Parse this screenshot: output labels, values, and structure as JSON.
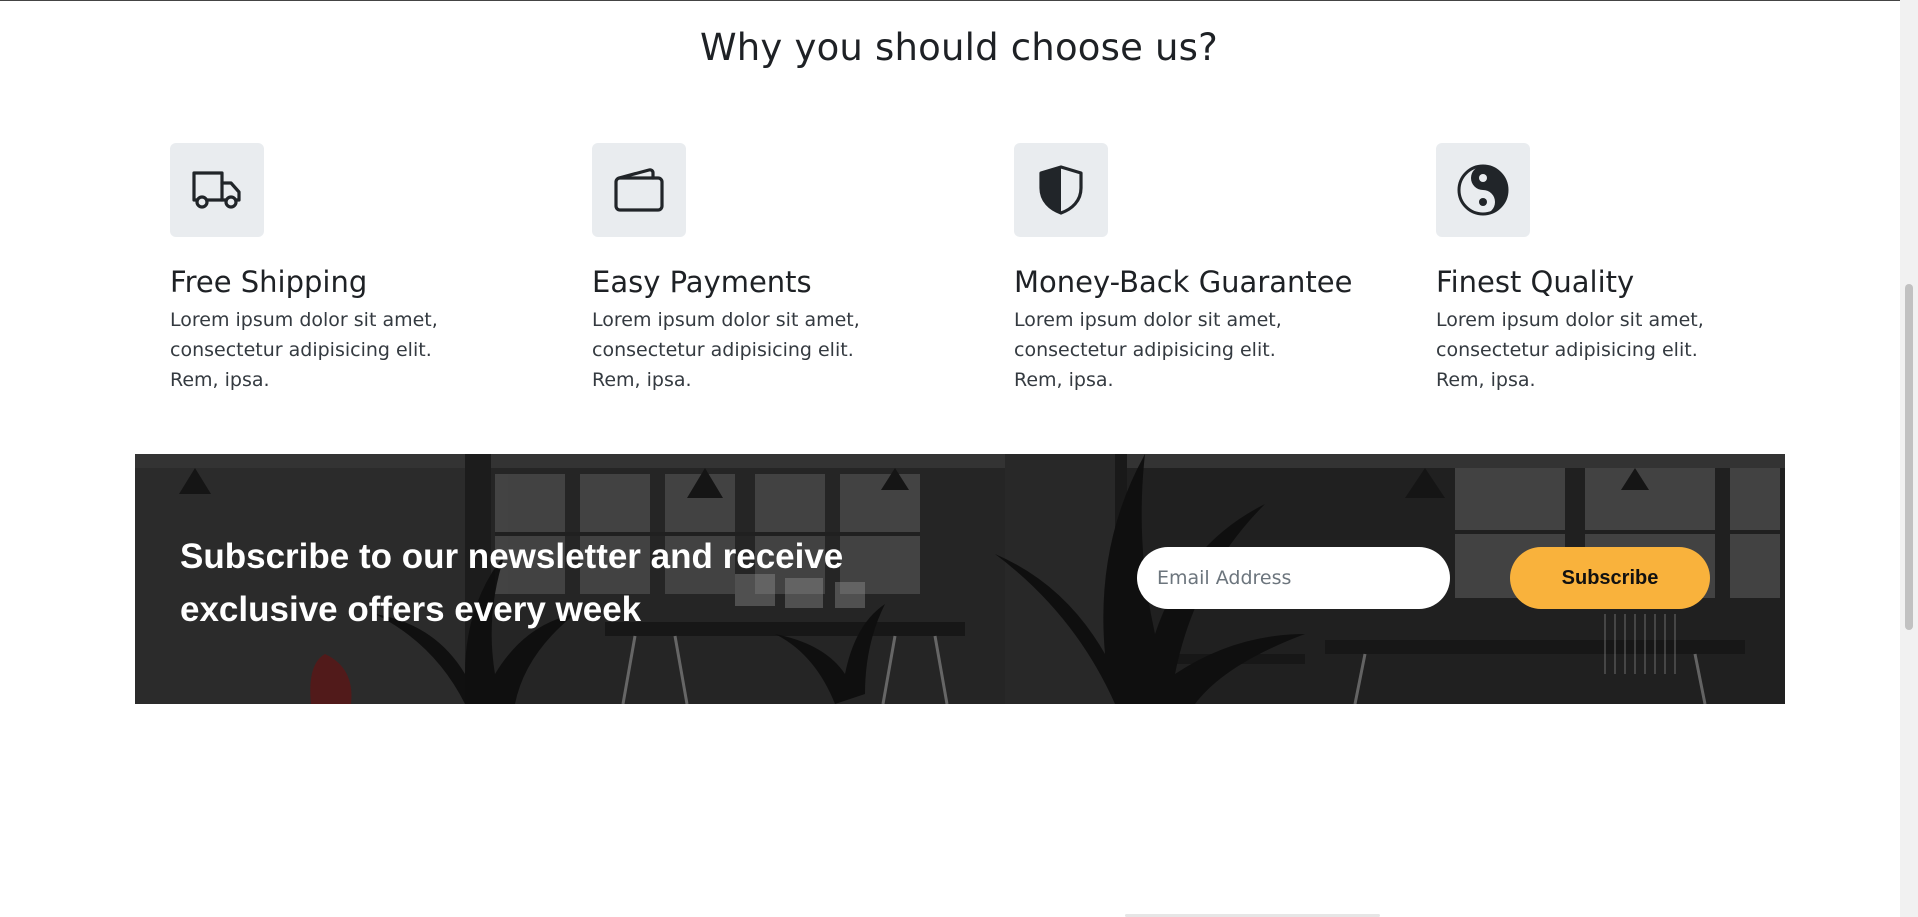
{
  "section": {
    "title": "Why you should choose us?"
  },
  "features": [
    {
      "icon": "truck-icon",
      "title": "Free Shipping",
      "text": "Lorem ipsum dolor sit amet, consectetur adipisicing elit. Rem, ipsa."
    },
    {
      "icon": "wallet-icon",
      "title": "Easy Payments",
      "text": "Lorem ipsum dolor sit amet, consectetur adipisicing elit. Rem, ipsa."
    },
    {
      "icon": "shield-half-icon",
      "title": "Money-Back Guarantee",
      "text": "Lorem ipsum dolor sit amet, consectetur adipisicing elit. Rem, ipsa."
    },
    {
      "icon": "yin-yang-icon",
      "title": "Finest Quality",
      "text": "Lorem ipsum dolor sit amet, consectetur adipisicing elit. Rem, ipsa."
    }
  ],
  "newsletter": {
    "heading": "Subscribe to our newsletter and receive exclusive offers every week",
    "email_placeholder": "Email Address",
    "button_label": "Subscribe",
    "accent_color": "#f9b23c"
  }
}
